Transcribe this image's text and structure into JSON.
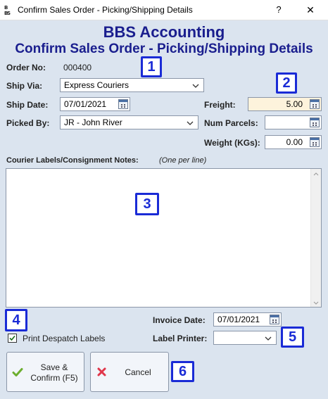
{
  "window": {
    "title": "Confirm Sales Order - Picking/Shipping Details",
    "icon_text": "BBS",
    "help_label": "?",
    "close_label": "✕"
  },
  "header": {
    "app_name": "BBS Accounting",
    "form_title": "Confirm Sales Order - Picking/Shipping Details"
  },
  "form": {
    "order_no_label": "Order No:",
    "order_no_value": "000400",
    "ship_via_label": "Ship Via:",
    "ship_via_value": "Express Couriers",
    "ship_date_label": "Ship Date:",
    "ship_date_value": "07/01/2021",
    "picked_by_label": "Picked By:",
    "picked_by_value": "JR - John River",
    "freight_label": "Freight:",
    "freight_value": "5.00",
    "num_parcels_label": "Num Parcels:",
    "num_parcels_value": "",
    "weight_label": "Weight (KGs):",
    "weight_value": "0.00",
    "notes_label": "Courier Labels/Consignment Notes:",
    "notes_hint": "(One per line)",
    "notes_value": "",
    "print_labels_label": "Print Despatch Labels",
    "print_labels_checked": true,
    "invoice_date_label": "Invoice Date:",
    "invoice_date_value": "07/01/2021",
    "label_printer_label": "Label Printer:",
    "label_printer_value": ""
  },
  "buttons": {
    "save_line1": "Save &",
    "save_line2": "Confirm (F5)",
    "cancel_label": "Cancel"
  },
  "callouts": [
    "1",
    "2",
    "3",
    "4",
    "5",
    "6"
  ],
  "colors": {
    "header_text": "#1a1e8e",
    "callout_border": "#1a2bd6",
    "freight_bg": "#fdf3dc",
    "dialog_bg": "#dbe4ef"
  },
  "icons": {
    "calendar": "calendar-icon",
    "dropdown": "chevron-down-icon",
    "save": "check-icon",
    "cancel": "x-icon"
  }
}
